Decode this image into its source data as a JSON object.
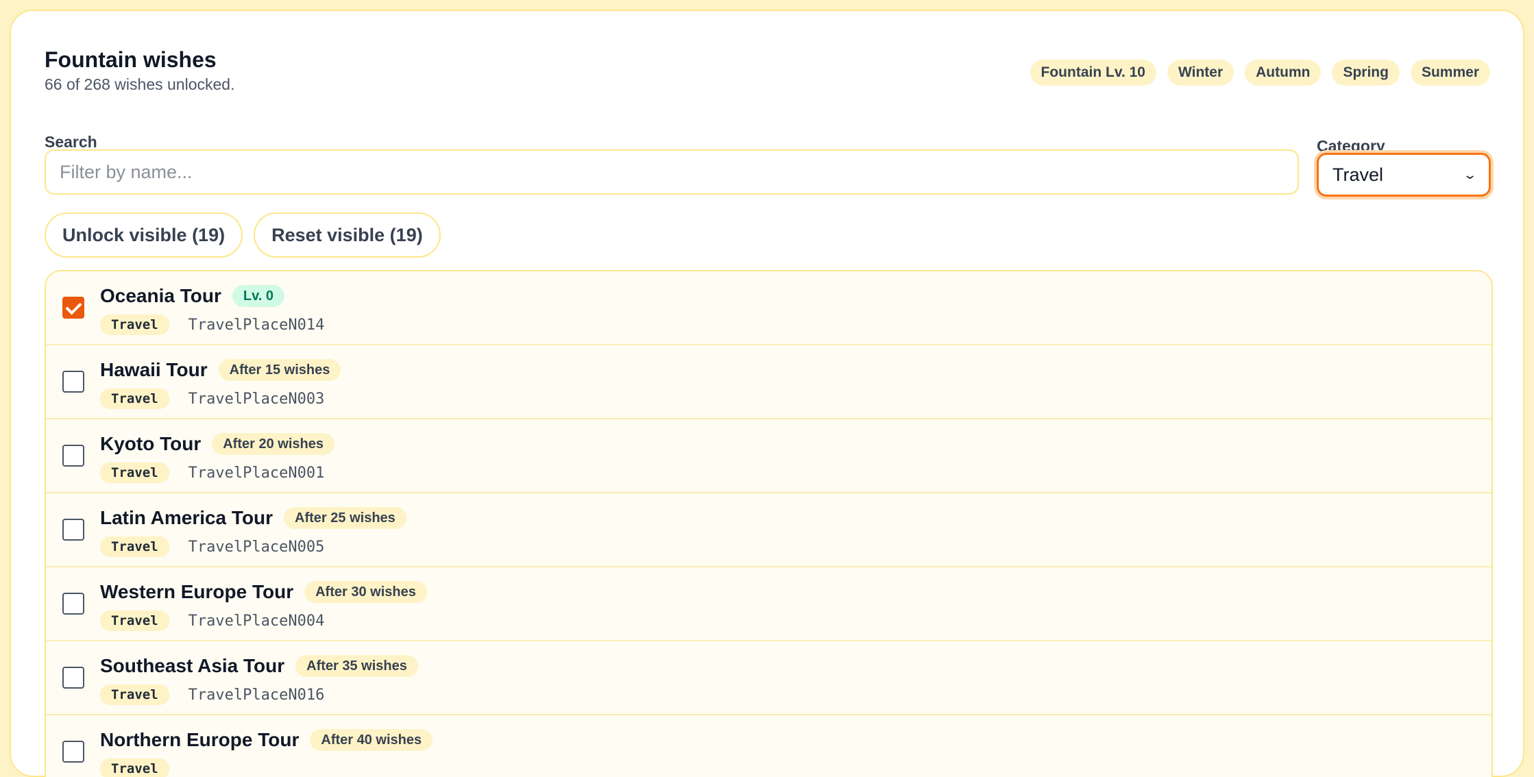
{
  "header": {
    "title": "Fountain wishes",
    "subtitle": "66 of 268 wishes unlocked."
  },
  "chips": [
    "Fountain Lv. 10",
    "Winter",
    "Autumn",
    "Spring",
    "Summer"
  ],
  "search": {
    "label": "Search",
    "placeholder": "Filter by name...",
    "value": ""
  },
  "category": {
    "label": "Category",
    "selected": "Travel"
  },
  "actions": {
    "unlock_label": "Unlock visible (19)",
    "reset_label": "Reset visible (19)"
  },
  "colors": {
    "accent": "#ea580c",
    "background": "#fef3c7",
    "border": "#fde68a",
    "level_badge": "#d1fae5"
  },
  "wishes": [
    {
      "name": "Oceania Tour",
      "badge": "Lv. 0",
      "badge_type": "level",
      "category": "Travel",
      "code": "TravelPlaceN014",
      "checked": true
    },
    {
      "name": "Hawaii Tour",
      "badge": "After 15 wishes",
      "badge_type": "pending",
      "category": "Travel",
      "code": "TravelPlaceN003",
      "checked": false
    },
    {
      "name": "Kyoto Tour",
      "badge": "After 20 wishes",
      "badge_type": "pending",
      "category": "Travel",
      "code": "TravelPlaceN001",
      "checked": false
    },
    {
      "name": "Latin America Tour",
      "badge": "After 25 wishes",
      "badge_type": "pending",
      "category": "Travel",
      "code": "TravelPlaceN005",
      "checked": false
    },
    {
      "name": "Western Europe Tour",
      "badge": "After 30 wishes",
      "badge_type": "pending",
      "category": "Travel",
      "code": "TravelPlaceN004",
      "checked": false
    },
    {
      "name": "Southeast Asia Tour",
      "badge": "After 35 wishes",
      "badge_type": "pending",
      "category": "Travel",
      "code": "TravelPlaceN016",
      "checked": false
    },
    {
      "name": "Northern Europe Tour",
      "badge": "After 40 wishes",
      "badge_type": "pending",
      "category": "Travel",
      "code": "",
      "checked": false
    }
  ]
}
